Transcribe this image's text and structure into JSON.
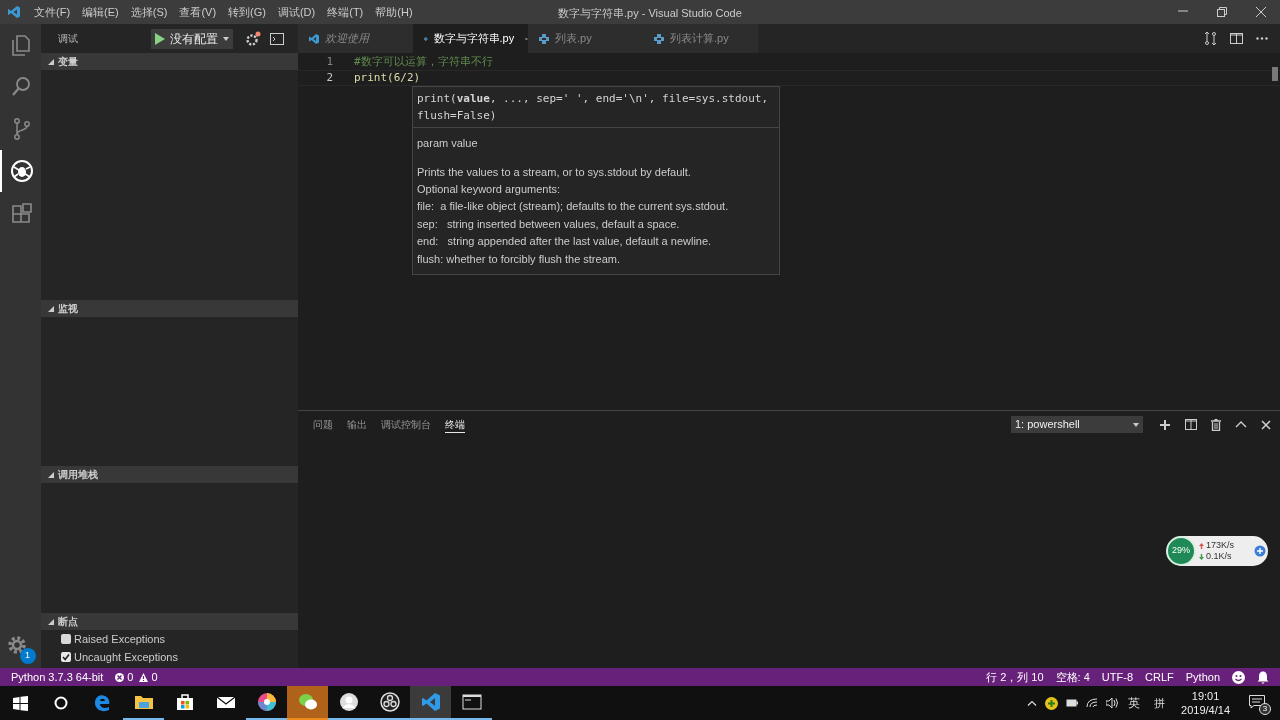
{
  "window": {
    "title": "数字与字符串.py - Visual Studio Code"
  },
  "menu": [
    "文件(F)",
    "编辑(E)",
    "选择(S)",
    "查看(V)",
    "转到(G)",
    "调试(D)",
    "终端(T)",
    "帮助(H)"
  ],
  "activity_bar": {
    "items": [
      {
        "kind": "files",
        "selected": false
      },
      {
        "kind": "search",
        "selected": false
      },
      {
        "kind": "scm",
        "selected": false
      },
      {
        "kind": "debug",
        "selected": true
      },
      {
        "kind": "extensions",
        "selected": false
      }
    ],
    "settings_badge": "1"
  },
  "sidebar": {
    "title": "调试",
    "config": "没有配置",
    "sections": [
      {
        "title": "变量",
        "expanded": true
      },
      {
        "title": "监视",
        "expanded": true
      },
      {
        "title": "调用堆栈",
        "expanded": true
      },
      {
        "title": "断点",
        "expanded": true
      }
    ],
    "breakpoints": [
      {
        "label": "Raised Exceptions",
        "checked": false
      },
      {
        "label": "Uncaught Exceptions",
        "checked": true
      }
    ]
  },
  "tabs": [
    {
      "label": "欢迎使用",
      "kind": "welcome",
      "selected": false,
      "preview": true
    },
    {
      "label": "数字与字符串.py",
      "kind": "python",
      "selected": true,
      "preview": false
    },
    {
      "label": "列表.py",
      "kind": "python",
      "selected": false,
      "preview": false
    },
    {
      "label": "列表计算.py",
      "kind": "python",
      "selected": false,
      "preview": false
    }
  ],
  "editor": {
    "lines": [
      {
        "number": "1",
        "text": "#数字可以运算，字符串不行",
        "kind": "comment"
      },
      {
        "number": "2",
        "text": "print(6/2)",
        "kind": "code"
      }
    ],
    "hover": {
      "signature": "print(**value**, ..., sep=' ', end='\\n', file=sys.stdout, flush=False)",
      "param": "param value",
      "doc": [
        "Prints the values to a stream, or to sys.stdout by default.",
        "Optional keyword arguments:",
        "file:  a file-like object (stream); defaults to the current sys.stdout.",
        "sep:   string inserted between values, default a space.",
        "end:   string appended after the last value, default a newline.",
        "flush: whether to forcibly flush the stream."
      ]
    }
  },
  "panel": {
    "tabs": [
      {
        "label": "问题",
        "selected": false
      },
      {
        "label": "输出",
        "selected": false
      },
      {
        "label": "调试控制台",
        "selected": false
      },
      {
        "label": "终端",
        "selected": true
      }
    ],
    "terminal": "1: powershell"
  },
  "net_widget": {
    "percent": "29%",
    "up": "173K/s",
    "down": "0.1K/s"
  },
  "status_bar": {
    "interpreter": "Python 3.7.3 64-bit",
    "errors": "0",
    "warnings": "0",
    "position": "行 2，列 10",
    "indent": "空格: 4",
    "encoding": "UTF-8",
    "eol": "CRLF",
    "language": "Python"
  },
  "taskbar": {
    "apps": [
      {
        "kind": "edge",
        "running": false,
        "selected": false,
        "attention": false
      },
      {
        "kind": "folder",
        "running": true,
        "selected": false,
        "attention": false
      },
      {
        "kind": "store",
        "running": false,
        "selected": false,
        "attention": false
      },
      {
        "kind": "mail",
        "running": false,
        "selected": false,
        "attention": false
      },
      {
        "kind": "pinwheel",
        "running": true,
        "selected": false,
        "attention": false
      },
      {
        "kind": "chat",
        "running": true,
        "selected": false,
        "attention": true
      },
      {
        "kind": "avatar",
        "running": true,
        "selected": false,
        "attention": false
      },
      {
        "kind": "obs",
        "running": true,
        "selected": false,
        "attention": false
      },
      {
        "kind": "vscode",
        "running": true,
        "selected": true,
        "attention": false
      },
      {
        "kind": "terminal",
        "running": true,
        "selected": false,
        "attention": false
      }
    ],
    "ime_lang": "英",
    "ime_mode": "拼",
    "time": "19:01",
    "date": "2019/4/14",
    "notifications": "3"
  }
}
